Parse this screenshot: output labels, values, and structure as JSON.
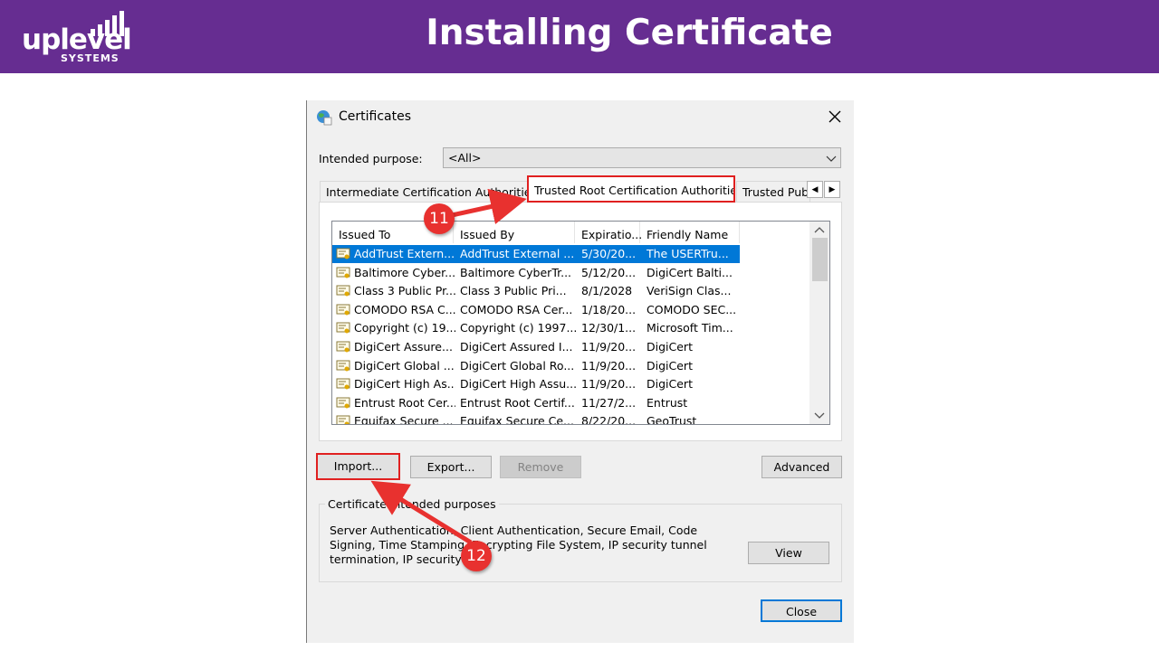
{
  "slide": {
    "title": "Installing Certificate",
    "logo_word": "uplevel",
    "logo_sub": "SYSTEMS"
  },
  "dialog": {
    "title": "Certificates",
    "intended_purpose_label": "Intended purpose:",
    "intended_purpose_value": "<All>",
    "tabs": [
      "Intermediate Certification Authorities",
      "Trusted Root Certification Authorities",
      "Trusted Publishers"
    ],
    "columns": [
      "Issued To",
      "Issued By",
      "Expiratio...",
      "Friendly Name"
    ],
    "rows": [
      [
        "AddTrust Extern...",
        "AddTrust External ...",
        "5/30/20...",
        "The USERTru..."
      ],
      [
        "Baltimore Cyber...",
        "Baltimore CyberTr...",
        "5/12/20...",
        "DigiCert Balti..."
      ],
      [
        "Class 3 Public Pr...",
        "Class 3 Public Pri...",
        "8/1/2028",
        "VeriSign Clas..."
      ],
      [
        "COMODO RSA C...",
        "COMODO RSA Cer...",
        "1/18/20...",
        "COMODO SEC..."
      ],
      [
        "Copyright (c) 19...",
        "Copyright (c) 1997...",
        "12/30/1...",
        "Microsoft Tim..."
      ],
      [
        "DigiCert Assure...",
        "DigiCert Assured I...",
        "11/9/20...",
        "DigiCert"
      ],
      [
        "DigiCert Global ...",
        "DigiCert Global Ro...",
        "11/9/20...",
        "DigiCert"
      ],
      [
        "DigiCert High As...",
        "DigiCert High Assu...",
        "11/9/20...",
        "DigiCert"
      ],
      [
        "Entrust Root Cer...",
        "Entrust Root Certif...",
        "11/27/2...",
        "Entrust"
      ],
      [
        "Equifax Secure ...",
        "Equifax Secure Ce...",
        "8/22/20...",
        "GeoTrust"
      ]
    ],
    "buttons": {
      "import": "Import...",
      "export": "Export...",
      "remove": "Remove",
      "advanced": "Advanced",
      "view": "View",
      "close": "Close"
    },
    "purposes_group_label": "Certificate intended purposes",
    "purposes_text": "Server Authentication, Client Authentication, Secure Email, Code Signing, Time Stamping, Encrypting File System, IP security tunnel termination, IP security user"
  },
  "callouts": [
    "11",
    "12"
  ],
  "colors": {
    "banner": "#662d91",
    "highlight": "#e02020",
    "selection": "#0078d7"
  }
}
